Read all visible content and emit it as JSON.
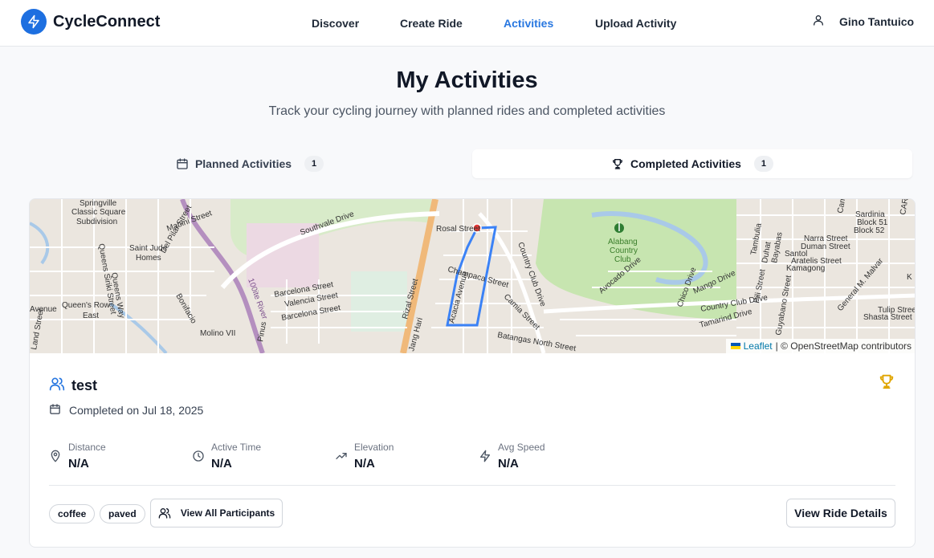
{
  "app": {
    "name": "CycleConnect",
    "brand_color": "#1d6fe0",
    "active_color": "#2877e0"
  },
  "nav": {
    "items": [
      "Discover",
      "Create Ride",
      "Activities",
      "Upload Activity"
    ],
    "active": "Activities"
  },
  "user": {
    "name": "Gino Tantuico",
    "icon": "user-icon"
  },
  "page": {
    "title": "My Activities",
    "subtitle": "Track your cycling journey with planned rides and completed activities"
  },
  "tabs": [
    {
      "label": "Planned Activities",
      "count": "1",
      "icon": "calendar-icon",
      "selected": false
    },
    {
      "label": "Completed Activities",
      "count": "1",
      "icon": "trophy-icon",
      "selected": true
    }
  ],
  "activity": {
    "title": "test",
    "completed": "Completed on Jul 18, 2025",
    "stats": [
      {
        "label": "Distance",
        "value": "N/A",
        "icon": "map-pin-icon"
      },
      {
        "label": "Active Time",
        "value": "N/A",
        "icon": "clock-icon"
      },
      {
        "label": "Elevation",
        "value": "N/A",
        "icon": "trending-up-icon"
      },
      {
        "label": "Avg Speed",
        "value": "N/A",
        "icon": "zap-icon"
      }
    ],
    "tags": [
      "coffee",
      "paved"
    ],
    "participants_button": "View All Participants",
    "details_button": "View Ride Details",
    "trophy_color": "#e0a500"
  },
  "map": {
    "attribution_link": "Leaflet",
    "attribution_text": "| © OpenStreetMap contributors",
    "labels": {
      "springville": "Springville",
      "classic_square": "Classic Square",
      "subdivision": "Subdivision",
      "southvale": "Southvale Drive",
      "mabini": "Mabini Street",
      "del_pilar": "Del Pilar Street",
      "queens_siriki": "Queens Siriki Street",
      "queens_way": "Queens Way",
      "rizal": "Rizal Street",
      "saint_jude": "Saint Jude",
      "homes": "Homes",
      "queens_row": "Queen's Row",
      "east": "East",
      "avenue": "Avenue",
      "bonifacio": "Bonifacio",
      "molino": "Molino VII",
      "land_street": "Land Street",
      "barcelona1": "Barcelona Street",
      "valencia": "Valencia Street",
      "barcelona2": "Barcelona Street",
      "rosal": "Rosal Street",
      "champaca": "Champaca Street",
      "acacia": "Acacia Avenue",
      "camia": "Camia Street",
      "batangas": "Batangas North Street",
      "country_club_drive": "Country Club Drive",
      "alabang_country_club": [
        "Alabang",
        "Country",
        "Club"
      ],
      "avocado": "Avocado Drive",
      "chico": "Chico Drive",
      "mango": "Mango Drive",
      "tamarind": "Tamarind Drive",
      "country_club_drive2": "Country Club Drive",
      "pili": "Pili Street",
      "guyabano": "Guyabano Street",
      "general_malvar": "General M. Malvar",
      "sardinia": "Sardinia",
      "block51": "Block 51",
      "block52": "Block 52",
      "narra": "Narra Street",
      "duman": "Duman Street",
      "santol": "Santol",
      "aratelis": "Aratelis Street",
      "kamagong": "Kamagong",
      "tulip": "Tulip Street",
      "shasta": "Shasta Street",
      "cam": "Came",
      "cares": "CARES",
      "dahlia": "Tambulia",
      "bayabas": "Bayabas",
      "duhat": "Duhat",
      "alunan": "Alunan",
      "river": "100ite River",
      "pinus": "Pinus",
      "jang_hari": "Jang Hari",
      "k": "K"
    }
  }
}
